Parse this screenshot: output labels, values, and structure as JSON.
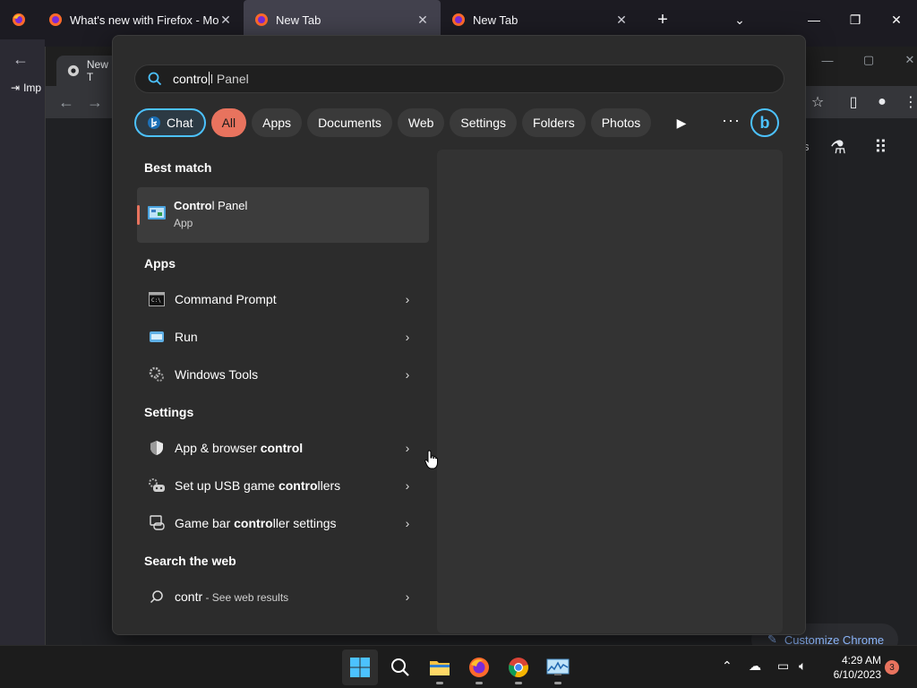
{
  "firefox": {
    "tabs": [
      {
        "title": "What's new with Firefox - More"
      },
      {
        "title": "New Tab"
      },
      {
        "title": "New Tab"
      }
    ],
    "imp_label": "Imp"
  },
  "chrome": {
    "tab_title": "New T",
    "customize_label": "Customize Chrome",
    "partial_label": "s"
  },
  "search": {
    "typed": "contro",
    "suggestion_rest": "l Panel"
  },
  "filters": {
    "chat": "Chat",
    "all": "All",
    "apps": "Apps",
    "documents": "Documents",
    "web": "Web",
    "settings": "Settings",
    "folders": "Folders",
    "photos": "Photos"
  },
  "sections": {
    "best_match": "Best match",
    "apps": "Apps",
    "settings": "Settings",
    "search_web": "Search the web"
  },
  "best_match": {
    "title_bold": "Contro",
    "title_rest": "l Panel",
    "subtitle": "App"
  },
  "apps": [
    {
      "label": "Command Prompt"
    },
    {
      "label": "Run"
    },
    {
      "label": "Windows Tools"
    }
  ],
  "settings": [
    {
      "pre": "App & browser ",
      "bold": "control",
      "post": ""
    },
    {
      "pre": "Set up USB game ",
      "bold": "contro",
      "post": "llers"
    },
    {
      "pre": "Game bar ",
      "bold": "contro",
      "post": "ller settings"
    }
  ],
  "web": {
    "query": "contr",
    "suffix": " - See web results"
  },
  "taskbar": {
    "time": "4:29 AM",
    "date": "6/10/2023",
    "notification_count": "3"
  },
  "colors": {
    "accent": "#e8735e",
    "chat_border": "#4cc2ff",
    "flyout_bg": "#2c2c2c"
  }
}
